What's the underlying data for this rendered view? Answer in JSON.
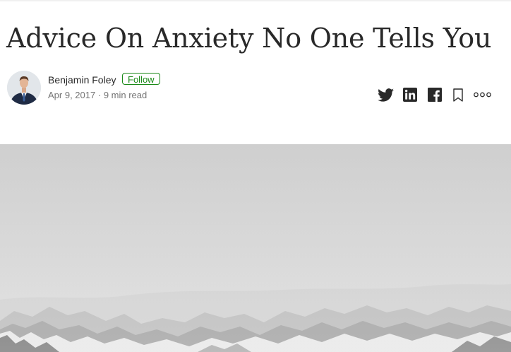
{
  "article": {
    "title": "Advice On Anxiety No One Tells You"
  },
  "author": {
    "name": "Benjamin Foley",
    "follow_label": "Follow",
    "date": "Apr 9, 2017",
    "separator": "·",
    "read_time": "9 min read"
  },
  "share_bar": {
    "icons": [
      "twitter-icon",
      "linkedin-icon",
      "facebook-icon",
      "bookmark-icon",
      "more-icon"
    ]
  },
  "hero_image": {
    "subject": "snowy mountains under foggy overcast sky"
  },
  "colors": {
    "text": "#292929",
    "meta": "#757575",
    "follow_green": "#1a8917",
    "fog": "#d3d3d3"
  }
}
